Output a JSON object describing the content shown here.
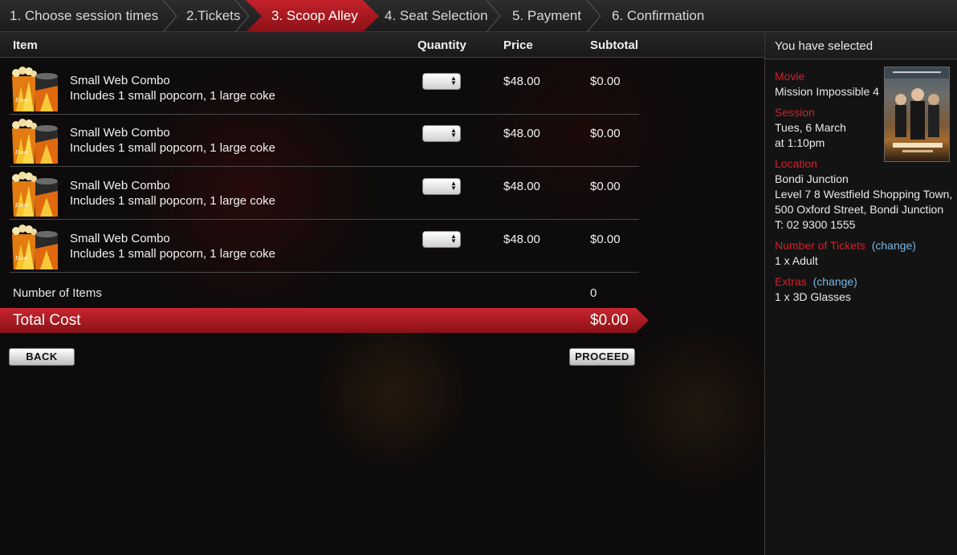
{
  "steps": [
    {
      "label": "1. Choose session times"
    },
    {
      "label": "2.Tickets"
    },
    {
      "label": "3. Scoop Alley"
    },
    {
      "label": "4. Seat Selection"
    },
    {
      "label": "5. Payment"
    },
    {
      "label": "6. Confirmation"
    }
  ],
  "active_step": 3,
  "table": {
    "headers": {
      "item": "Item",
      "quantity": "Quantity",
      "price": "Price",
      "subtotal": "Subtotal"
    },
    "rows": [
      {
        "name": "Small Web Combo",
        "description": "Includes 1 small popcorn, 1 large coke",
        "quantity": "",
        "price": "$48.00",
        "subtotal": "$0.00",
        "image": "popcorn-combo-icon"
      },
      {
        "name": "Small Web Combo",
        "description": "Includes 1 small popcorn, 1 large coke",
        "quantity": "",
        "price": "$48.00",
        "subtotal": "$0.00",
        "image": "popcorn-combo-icon"
      },
      {
        "name": "Small Web Combo",
        "description": "Includes 1 small popcorn, 1 large coke",
        "quantity": "",
        "price": "$48.00",
        "subtotal": "$0.00",
        "image": "popcorn-combo-icon"
      },
      {
        "name": "Small Web Combo",
        "description": "Includes 1 small popcorn, 1 large coke",
        "quantity": "",
        "price": "$48.00",
        "subtotal": "$0.00",
        "image": "popcorn-combo-icon"
      }
    ],
    "number_of_items_label": "Number of Items",
    "number_of_items": "0",
    "total_label": "Total Cost",
    "total_value": "$0.00"
  },
  "buttons": {
    "back": "BACK",
    "proceed": "PROCEED"
  },
  "summary": {
    "title": "You have selected",
    "movie_label": "Movie",
    "movie": "Mission Impossible 4",
    "session_label": "Session",
    "session_date": "Tues, 6 March",
    "session_time": "at 1:10pm",
    "location_label": "Location",
    "location_name": "Bondi Junction",
    "location_line1": "Level 7 8 Westfield Shopping Town,",
    "location_line2": "500 Oxford Street, Bondi Junction",
    "location_phone": "T: 02 9300 1555",
    "tickets_label": "Number of Tickets",
    "tickets_change": "(change)",
    "tickets_value": "1 x Adult",
    "extras_label": "Extras",
    "extras_change": "(change)",
    "extras_value": "1 x 3D Glasses",
    "poster_image": "movie-poster-image"
  },
  "colors": {
    "accent": "#c3212a",
    "link": "#79b7e3",
    "background": "#0d0b0b"
  }
}
